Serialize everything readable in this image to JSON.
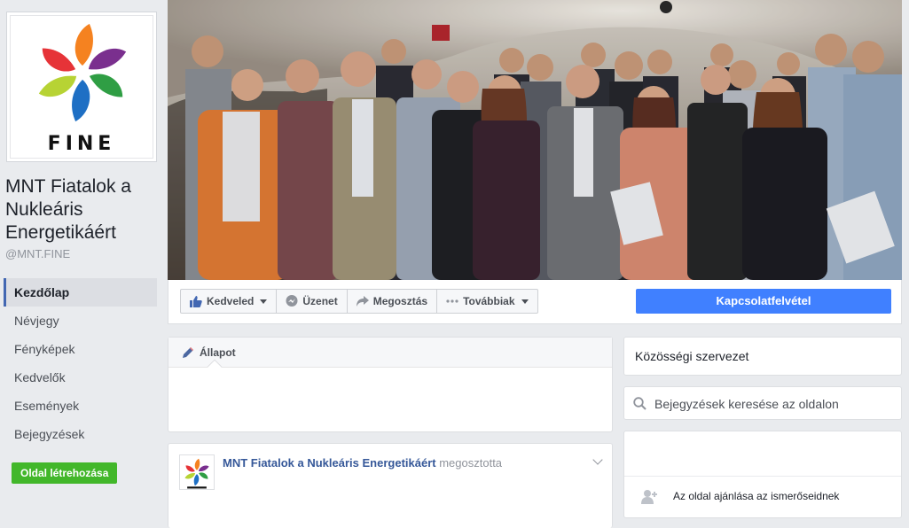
{
  "page": {
    "name": "MNT Fiatalok a Nukleáris Energetikáért",
    "handle": "@MNT.FINE",
    "logo_text": "FINE"
  },
  "nav": {
    "items": [
      {
        "label": "Kezdőlap",
        "active": true
      },
      {
        "label": "Névjegy"
      },
      {
        "label": "Fényképek"
      },
      {
        "label": "Kedvelők"
      },
      {
        "label": "Események"
      },
      {
        "label": "Bejegyzések"
      }
    ],
    "create_page_label": "Oldal létrehozása"
  },
  "actions": {
    "like_label": "Kedveled",
    "message_label": "Üzenet",
    "share_label": "Megosztás",
    "more_label": "Továbbiak",
    "contact_label": "Kapcsolatfelvétel"
  },
  "composer": {
    "tab_label": "Állapot"
  },
  "post": {
    "author": "MNT Fiatalok a Nukleáris Energetikáért",
    "action": "megosztotta"
  },
  "sidebar": {
    "category": "Közösségi szervezet",
    "search_placeholder": "Bejegyzések keresése az oldalon",
    "invite_label": "Az oldal ajánlása az ismerőseidnek"
  },
  "colors": {
    "brand_blue": "#4267b2",
    "contact_button": "#4080ff",
    "create_button": "#42b72a",
    "link": "#365899"
  },
  "icons": [
    "like-icon",
    "message-icon",
    "share-icon",
    "more-dots-icon",
    "pencil-icon",
    "search-icon",
    "add-friend-icon",
    "chevron-down-icon"
  ]
}
